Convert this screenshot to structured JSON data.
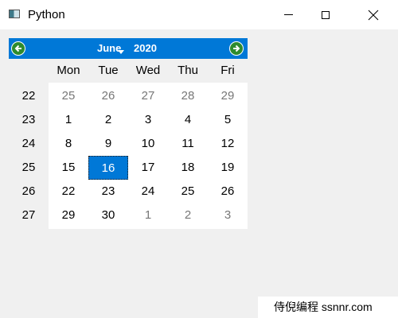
{
  "window": {
    "title": "Python",
    "icons": [
      "window-app-icon",
      "minimize-icon",
      "maximize-icon",
      "close-icon"
    ]
  },
  "calendar": {
    "month": "June",
    "year": "2020",
    "colors": {
      "accent": "#0078d7",
      "nav_arrow": "#2e8b2e",
      "other_month_text": "#777777"
    },
    "day_headers": [
      "Mon",
      "Tue",
      "Wed",
      "Thu",
      "Fri"
    ],
    "week_numbers": [
      "22",
      "23",
      "24",
      "25",
      "26",
      "27"
    ],
    "weeks": [
      [
        "25",
        "26",
        "27",
        "28",
        "29"
      ],
      [
        "1",
        "2",
        "3",
        "4",
        "5"
      ],
      [
        "8",
        "9",
        "10",
        "11",
        "12"
      ],
      [
        "15",
        "16",
        "17",
        "18",
        "19"
      ],
      [
        "22",
        "23",
        "24",
        "25",
        "26"
      ],
      [
        "29",
        "30",
        "1",
        "2",
        "3"
      ]
    ],
    "other_month": [
      [
        true,
        true,
        true,
        true,
        true
      ],
      [
        false,
        false,
        false,
        false,
        false
      ],
      [
        false,
        false,
        false,
        false,
        false
      ],
      [
        false,
        false,
        false,
        false,
        false
      ],
      [
        false,
        false,
        false,
        false,
        false
      ],
      [
        false,
        false,
        true,
        true,
        true
      ]
    ],
    "selected_date": "16"
  },
  "watermark": {
    "text": "侍倪编程 ssnnr.com"
  }
}
